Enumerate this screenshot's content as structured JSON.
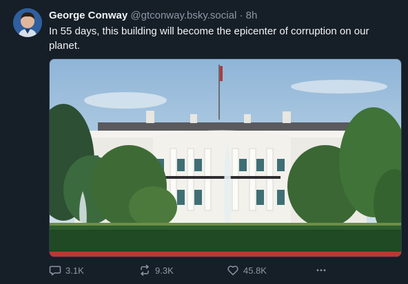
{
  "post": {
    "author_name": "George Conway",
    "handle": "@gtconway.bsky.social",
    "separator": "·",
    "time": "8h",
    "text": "In 55 days, this building will become the epicenter of corruption on our planet."
  },
  "actions": {
    "replies": "3.1K",
    "reposts": "9.3K",
    "likes": "45.8K",
    "reply_icon": "speech-bubble-icon",
    "repost_icon": "repost-arrows-icon",
    "like_icon": "heart-icon",
    "more_icon": "ellipsis-icon"
  },
  "colors": {
    "background": "#161e27",
    "text_primary": "#f1f3f5",
    "text_secondary": "#8b98a5"
  }
}
